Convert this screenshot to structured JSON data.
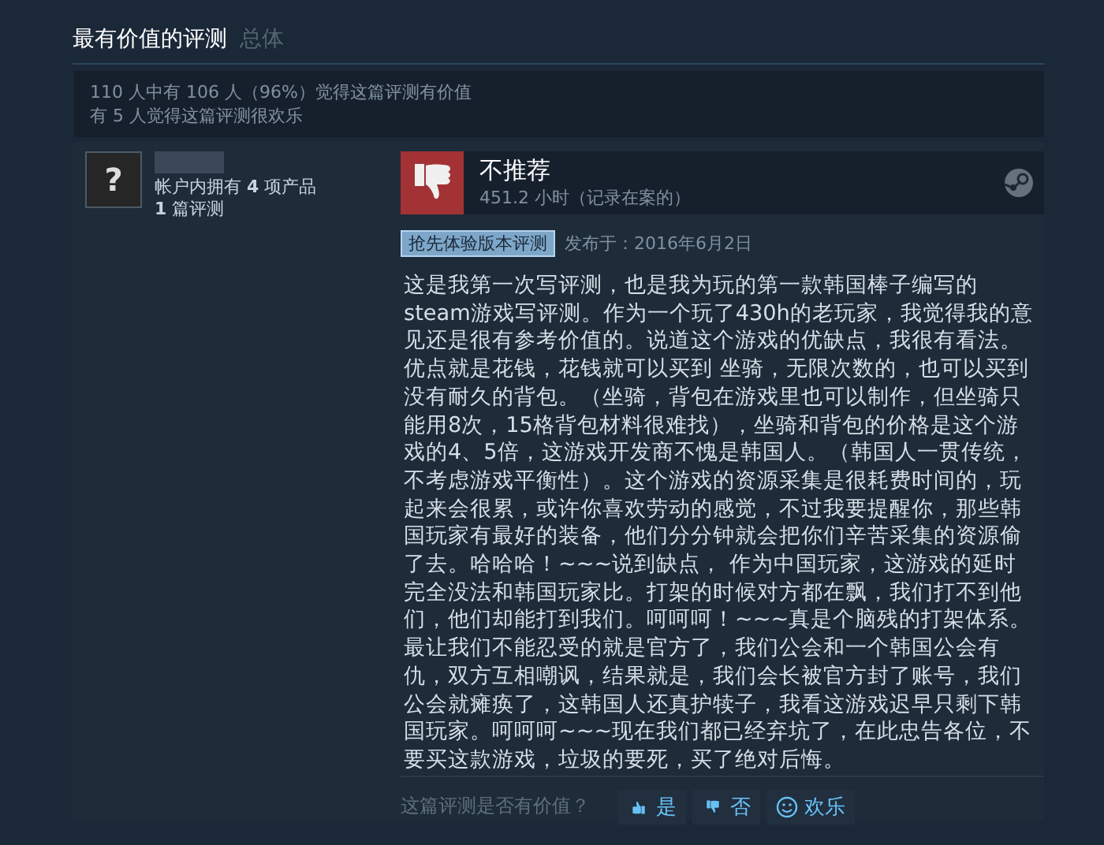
{
  "header": {
    "title": "最有价值的评测",
    "filter": "总体"
  },
  "stats": [
    "110 人中有 106 人（96%）觉得这篇评测有价值",
    "有 5 人觉得这篇评测很欢乐"
  ],
  "author": {
    "avatar": "?",
    "products": "帐户内拥有 **4** 项产品",
    "reviews": "**1** 篇评测"
  },
  "review": {
    "verdict": "不推荐",
    "recommended": false,
    "hours": "451.2 小时（记录在案的）",
    "badge": "抢先体验版本评测",
    "posted": "发布于：2016年6月2日",
    "body": "这是我第一次写评测，也是我为玩的第一款韩国棒子编写的steam游戏写评测。作为一个玩了430h的老玩家，我觉得我的意见还是很有参考价值的。说道这个游戏的优缺点，我很有看法。优点就是花钱，花钱就可以买到 坐骑，无限次数的，也可以买到没有耐久的背包。（坐骑，背包在游戏里也可以制作，但坐骑只能用8次，15格背包材料很难找），坐骑和背包的价格是这个游戏的4、5倍，这游戏开发商不愧是韩国人。（韩国人一贯传统，不考虑游戏平衡性）。这个游戏的资源采集是很耗费时间的，玩起来会很累，或许你喜欢劳动的感觉，不过我要提醒你，那些韩国玩家有最好的装备，他们分分钟就会把你们辛苦采集的资源偷了去。哈哈哈！~~~说到缺点， 作为中国玩家，这游戏的延时完全没法和韩国玩家比。打架的时候对方都在飘，我们打不到他们，他们却能打到我们。呵呵呵！~~~真是个脑残的打架体系。最让我们不能忍受的就是官方了，我们公会和一个韩国公会有仇，双方互相嘲讽，结果就是，我们会长被官方封了账号，我们公会就瘫痪了，这韩国人还真护犊子，我看这游戏迟早只剩下韩国玩家。呵呵呵~~~现在我们都已经弃坑了，在此忠告各位，不要买这款游戏，垃圾的要死，买了绝对后悔。"
  },
  "vote": {
    "question": "这篇评测是否有价值？",
    "buttons": [
      {
        "kind": "up",
        "label": "是"
      },
      {
        "kind": "down",
        "label": "否"
      },
      {
        "kind": "funny",
        "label": "欢乐"
      }
    ]
  }
}
